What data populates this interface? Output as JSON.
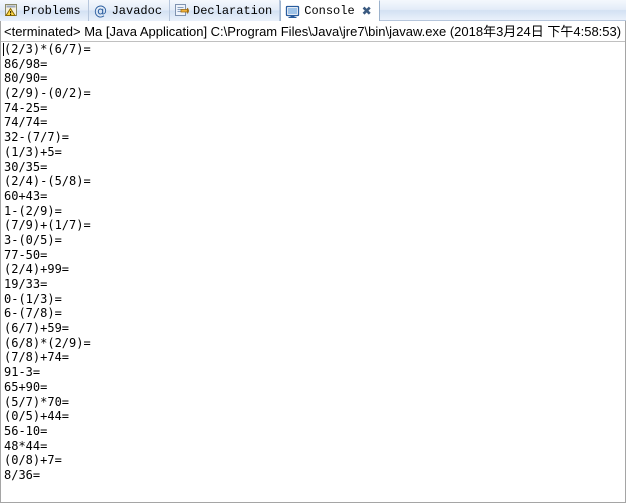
{
  "window": {
    "title": "Console"
  },
  "tabs": [
    {
      "label": "Problems",
      "icon": "problems-icon",
      "active": false,
      "closable": false
    },
    {
      "label": "Javadoc",
      "icon": "javadoc-icon",
      "active": false,
      "closable": false
    },
    {
      "label": "Declaration",
      "icon": "declaration-icon",
      "active": false,
      "closable": false
    },
    {
      "label": "Console",
      "icon": "console-icon",
      "active": true,
      "closable": true,
      "close_glyph": "✖"
    }
  ],
  "console": {
    "header": "<terminated> Ma [Java Application] C:\\Program Files\\Java\\jre7\\bin\\javaw.exe (2018年3月24日 下午4:58:53)",
    "lines": [
      "(2/3)*(6/7)=",
      "86/98=",
      "80/90=",
      "(2/9)-(0/2)=",
      "74-25=",
      "74/74=",
      "32-(7/7)=",
      "(1/3)+5=",
      "30/35=",
      "(2/4)-(5/8)=",
      "60+43=",
      "1-(2/9)=",
      "(7/9)+(1/7)=",
      "3-(0/5)=",
      "77-50=",
      "(2/4)+99=",
      "19/33=",
      "0-(1/3)=",
      "6-(7/8)=",
      "(6/7)+59=",
      "(6/8)*(2/9)=",
      "(7/8)+74=",
      "91-3=",
      "65+90=",
      "(5/7)*70=",
      "(0/5)+44=",
      "56-10=",
      "48*44=",
      "(0/8)+7=",
      "8/36="
    ]
  },
  "colors": {
    "tab_active_bg": "#ffffff",
    "tab_inactive_bg": "#e3ecf8",
    "tab_border": "#b6c6dc",
    "panel_border": "#a5a5a5",
    "text": "#000000",
    "close_icon": "#3b5a80"
  }
}
